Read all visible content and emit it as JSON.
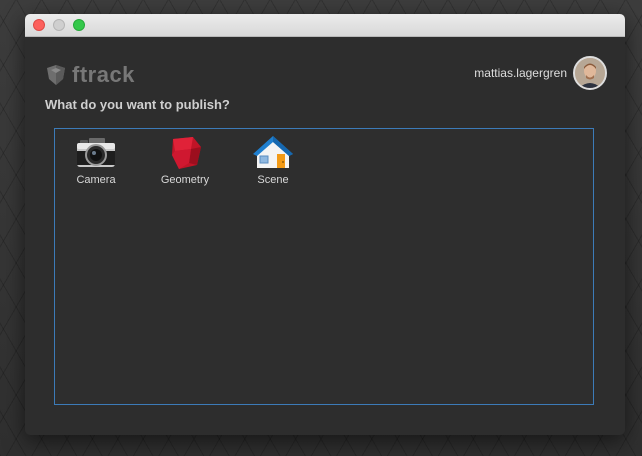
{
  "app": {
    "logo_text": "ftrack"
  },
  "user": {
    "name": "mattias.lagergren"
  },
  "question": "What do you want to publish?",
  "items": [
    {
      "label": "Camera",
      "icon": "camera-icon"
    },
    {
      "label": "Geometry",
      "icon": "geometry-icon"
    },
    {
      "label": "Scene",
      "icon": "house-icon"
    }
  ],
  "colors": {
    "accent_border": "#3c7bb8",
    "window_bg": "#2d2d2d",
    "geometry_red": "#d6192e",
    "house_blue": "#1f7fcf",
    "door_orange": "#f29a16"
  }
}
